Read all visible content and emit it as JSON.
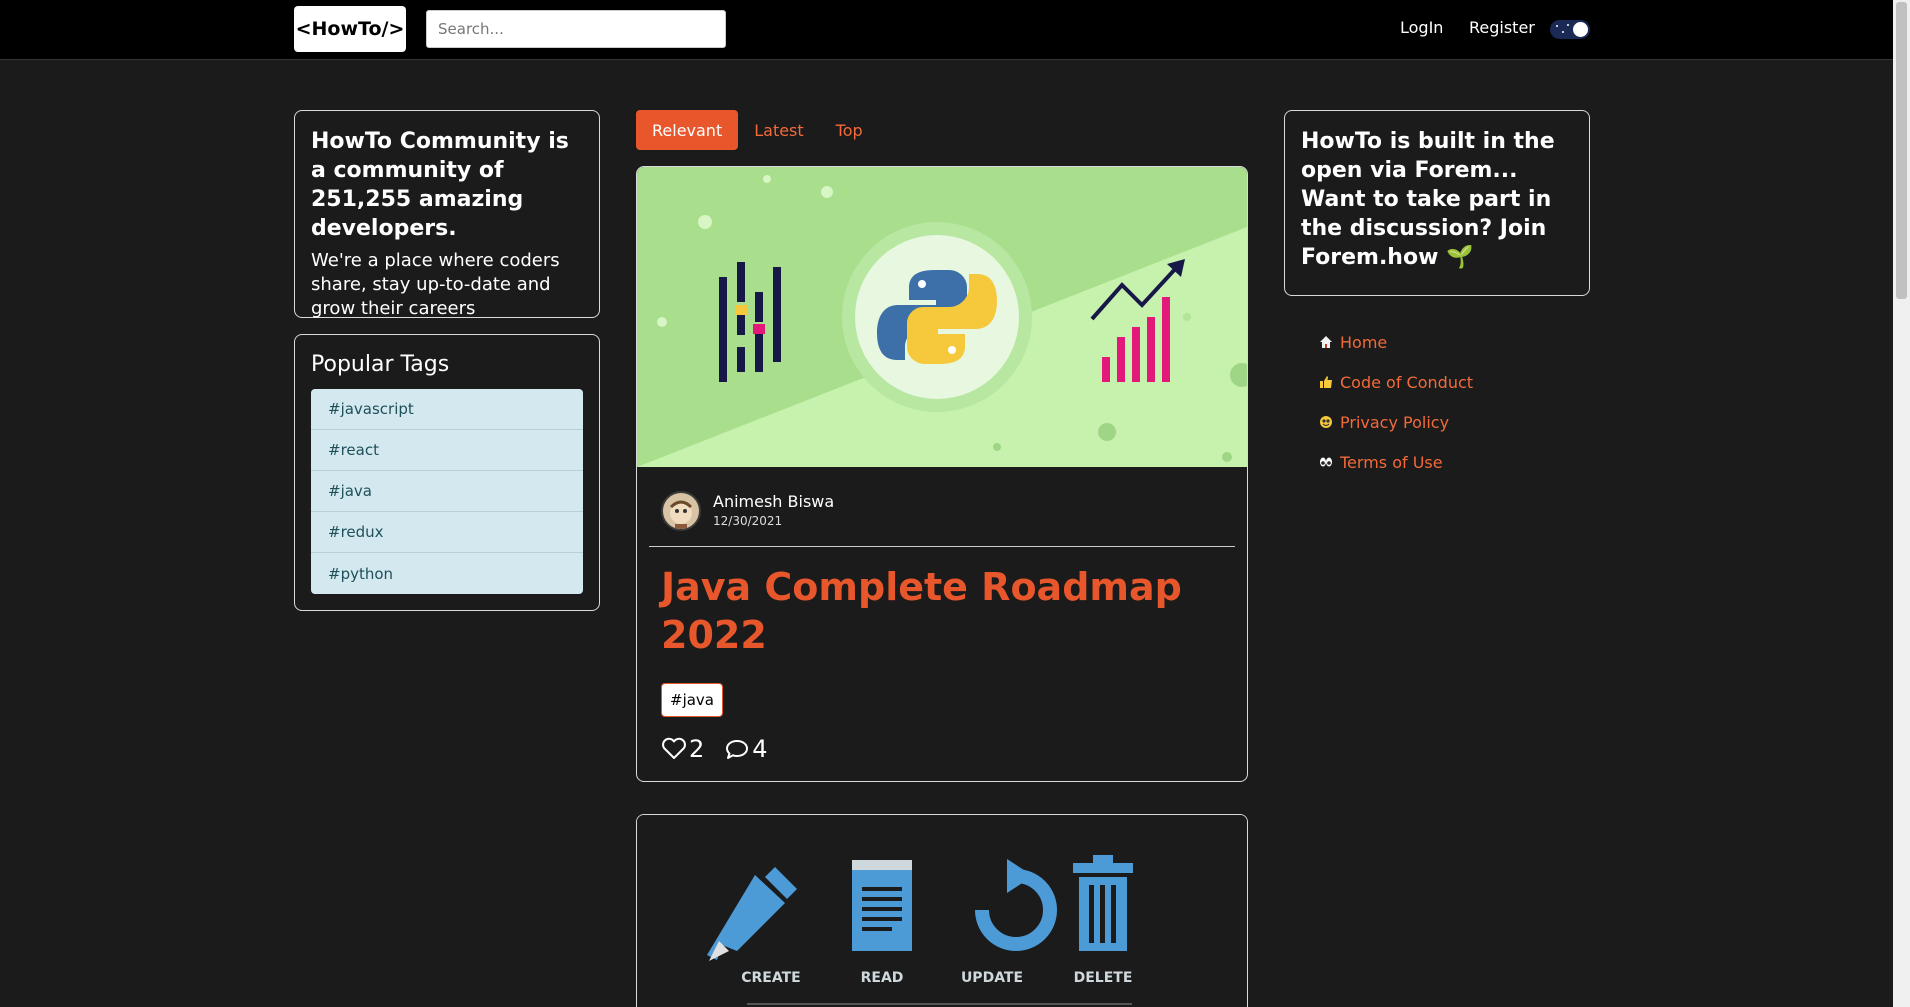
{
  "nav": {
    "logo": "<HowTo/>",
    "search_placeholder": "Search...",
    "login": "LogIn",
    "register": "Register"
  },
  "community": {
    "heading": "HowTo Community is a community of 251,255 amazing developers.",
    "description": "We're a place where coders share, stay up-to-date and grow their careers"
  },
  "popular_tags": {
    "title": "Popular Tags",
    "items": [
      "#javascript",
      "#react",
      "#java",
      "#redux",
      "#python"
    ]
  },
  "tabs": [
    "Relevant",
    "Latest",
    "Top"
  ],
  "posts": [
    {
      "author": "Animesh Biswa",
      "date": "12/30/2021",
      "title": "Java Complete Roadmap 2022",
      "tag": "#java",
      "likes": "2",
      "comments": "4"
    },
    {
      "labels": [
        "CREATE",
        "READ",
        "UPDATE",
        "DELETE"
      ]
    }
  ],
  "forem": {
    "text": "HowTo is built in the open via Forem... Want to take part in the discussion? Join Forem.how 🌱"
  },
  "side_links": [
    {
      "icon": "house-icon",
      "label": "Home"
    },
    {
      "icon": "thumbs-up-icon",
      "label": "Code of Conduct"
    },
    {
      "icon": "smile-icon",
      "label": "Privacy Policy"
    },
    {
      "icon": "eyes-icon",
      "label": "Terms of Use"
    }
  ],
  "colors": {
    "accent": "#e8572c",
    "background": "#1b1b1b",
    "tag_bg": "#d3e9ef"
  }
}
